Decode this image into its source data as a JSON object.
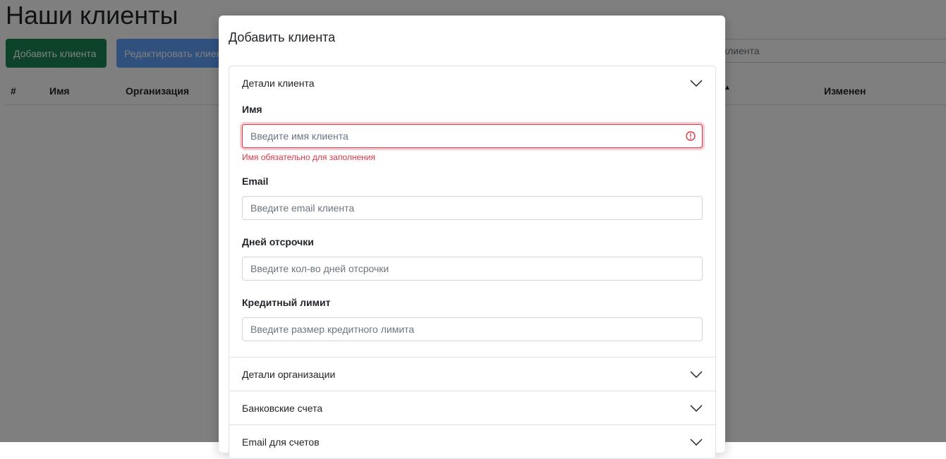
{
  "page": {
    "title": "Наши клиенты",
    "add_button": "Добавить клиента",
    "edit_button": "Редактировать клиента",
    "search_placeholder_visible": "и клиента",
    "table_headers": {
      "num": "#",
      "name": "Имя",
      "org": "Организация",
      "changed": "Изменен"
    }
  },
  "modal": {
    "title": "Добавить клиента",
    "sections": {
      "client_details": "Детали клиента",
      "org_details": "Детали организации",
      "bank_accounts": "Банковские счета",
      "invoice_email": "Email для счетов"
    },
    "fields": {
      "name": {
        "label": "Имя",
        "placeholder": "Введите имя клиента",
        "error": "Имя обязательно для заполнения"
      },
      "email": {
        "label": "Email",
        "placeholder": "Введите email клиента"
      },
      "deferral": {
        "label": "Дней отсрочки",
        "placeholder": "Введите кол-во дней отсрочки"
      },
      "credit": {
        "label": "Кредитный лимит",
        "placeholder": "Введите размер кредитного лимита"
      }
    }
  },
  "colors": {
    "success": "#198754",
    "primary": "#0d6efd",
    "danger": "#dc3545"
  }
}
